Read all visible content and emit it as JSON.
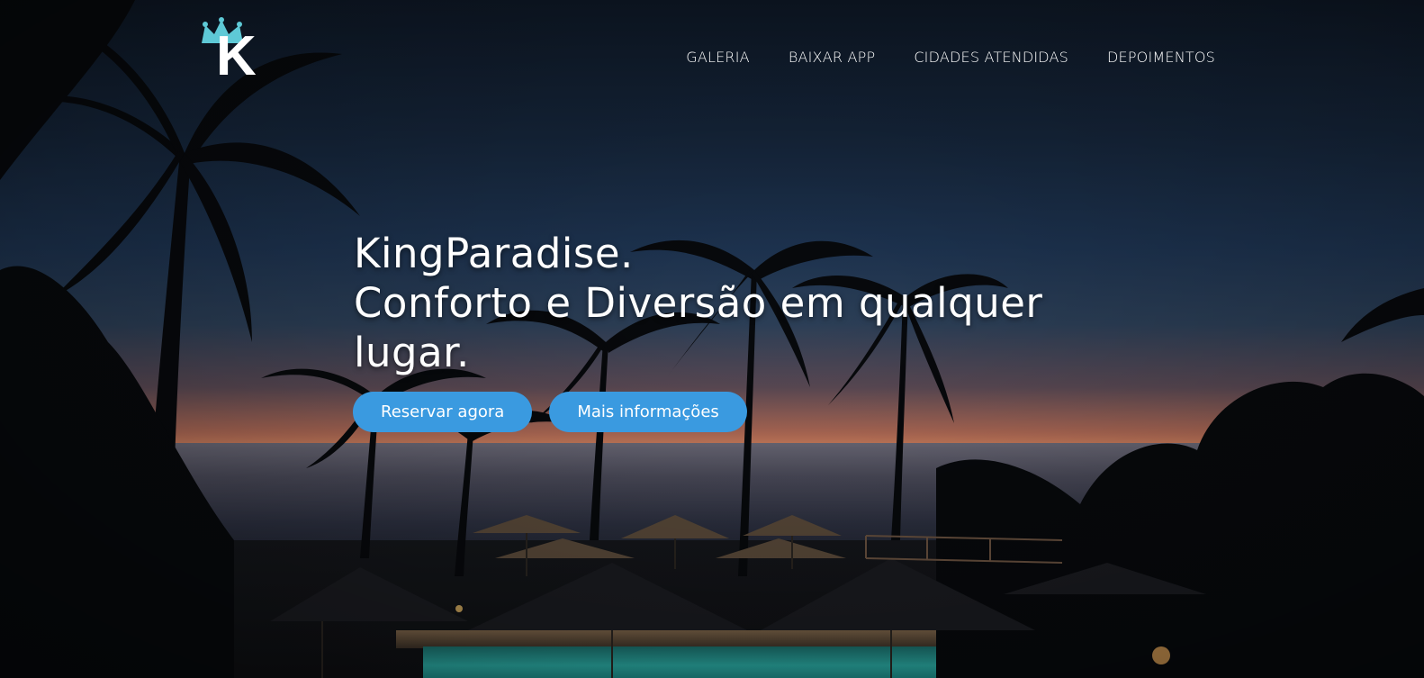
{
  "brand": {
    "logo_letter": "K"
  },
  "nav": {
    "items": [
      {
        "label": "GALERIA"
      },
      {
        "label": "BAIXAR APP"
      },
      {
        "label": "CIDADES ATENDIDAS"
      },
      {
        "label": "DEPOIMENTOS"
      }
    ]
  },
  "hero": {
    "line1": "KingParadise.",
    "line2": "Conforto e Diversão em qualquer",
    "line3": "lugar.",
    "primary_button": "Reservar agora",
    "secondary_button": "Mais informações"
  },
  "colors": {
    "button_bg": "#3a9ae0",
    "crown": "#5ec9d6",
    "text": "#ffffff"
  },
  "icons": {
    "logo": "crown-k-logo-icon"
  }
}
